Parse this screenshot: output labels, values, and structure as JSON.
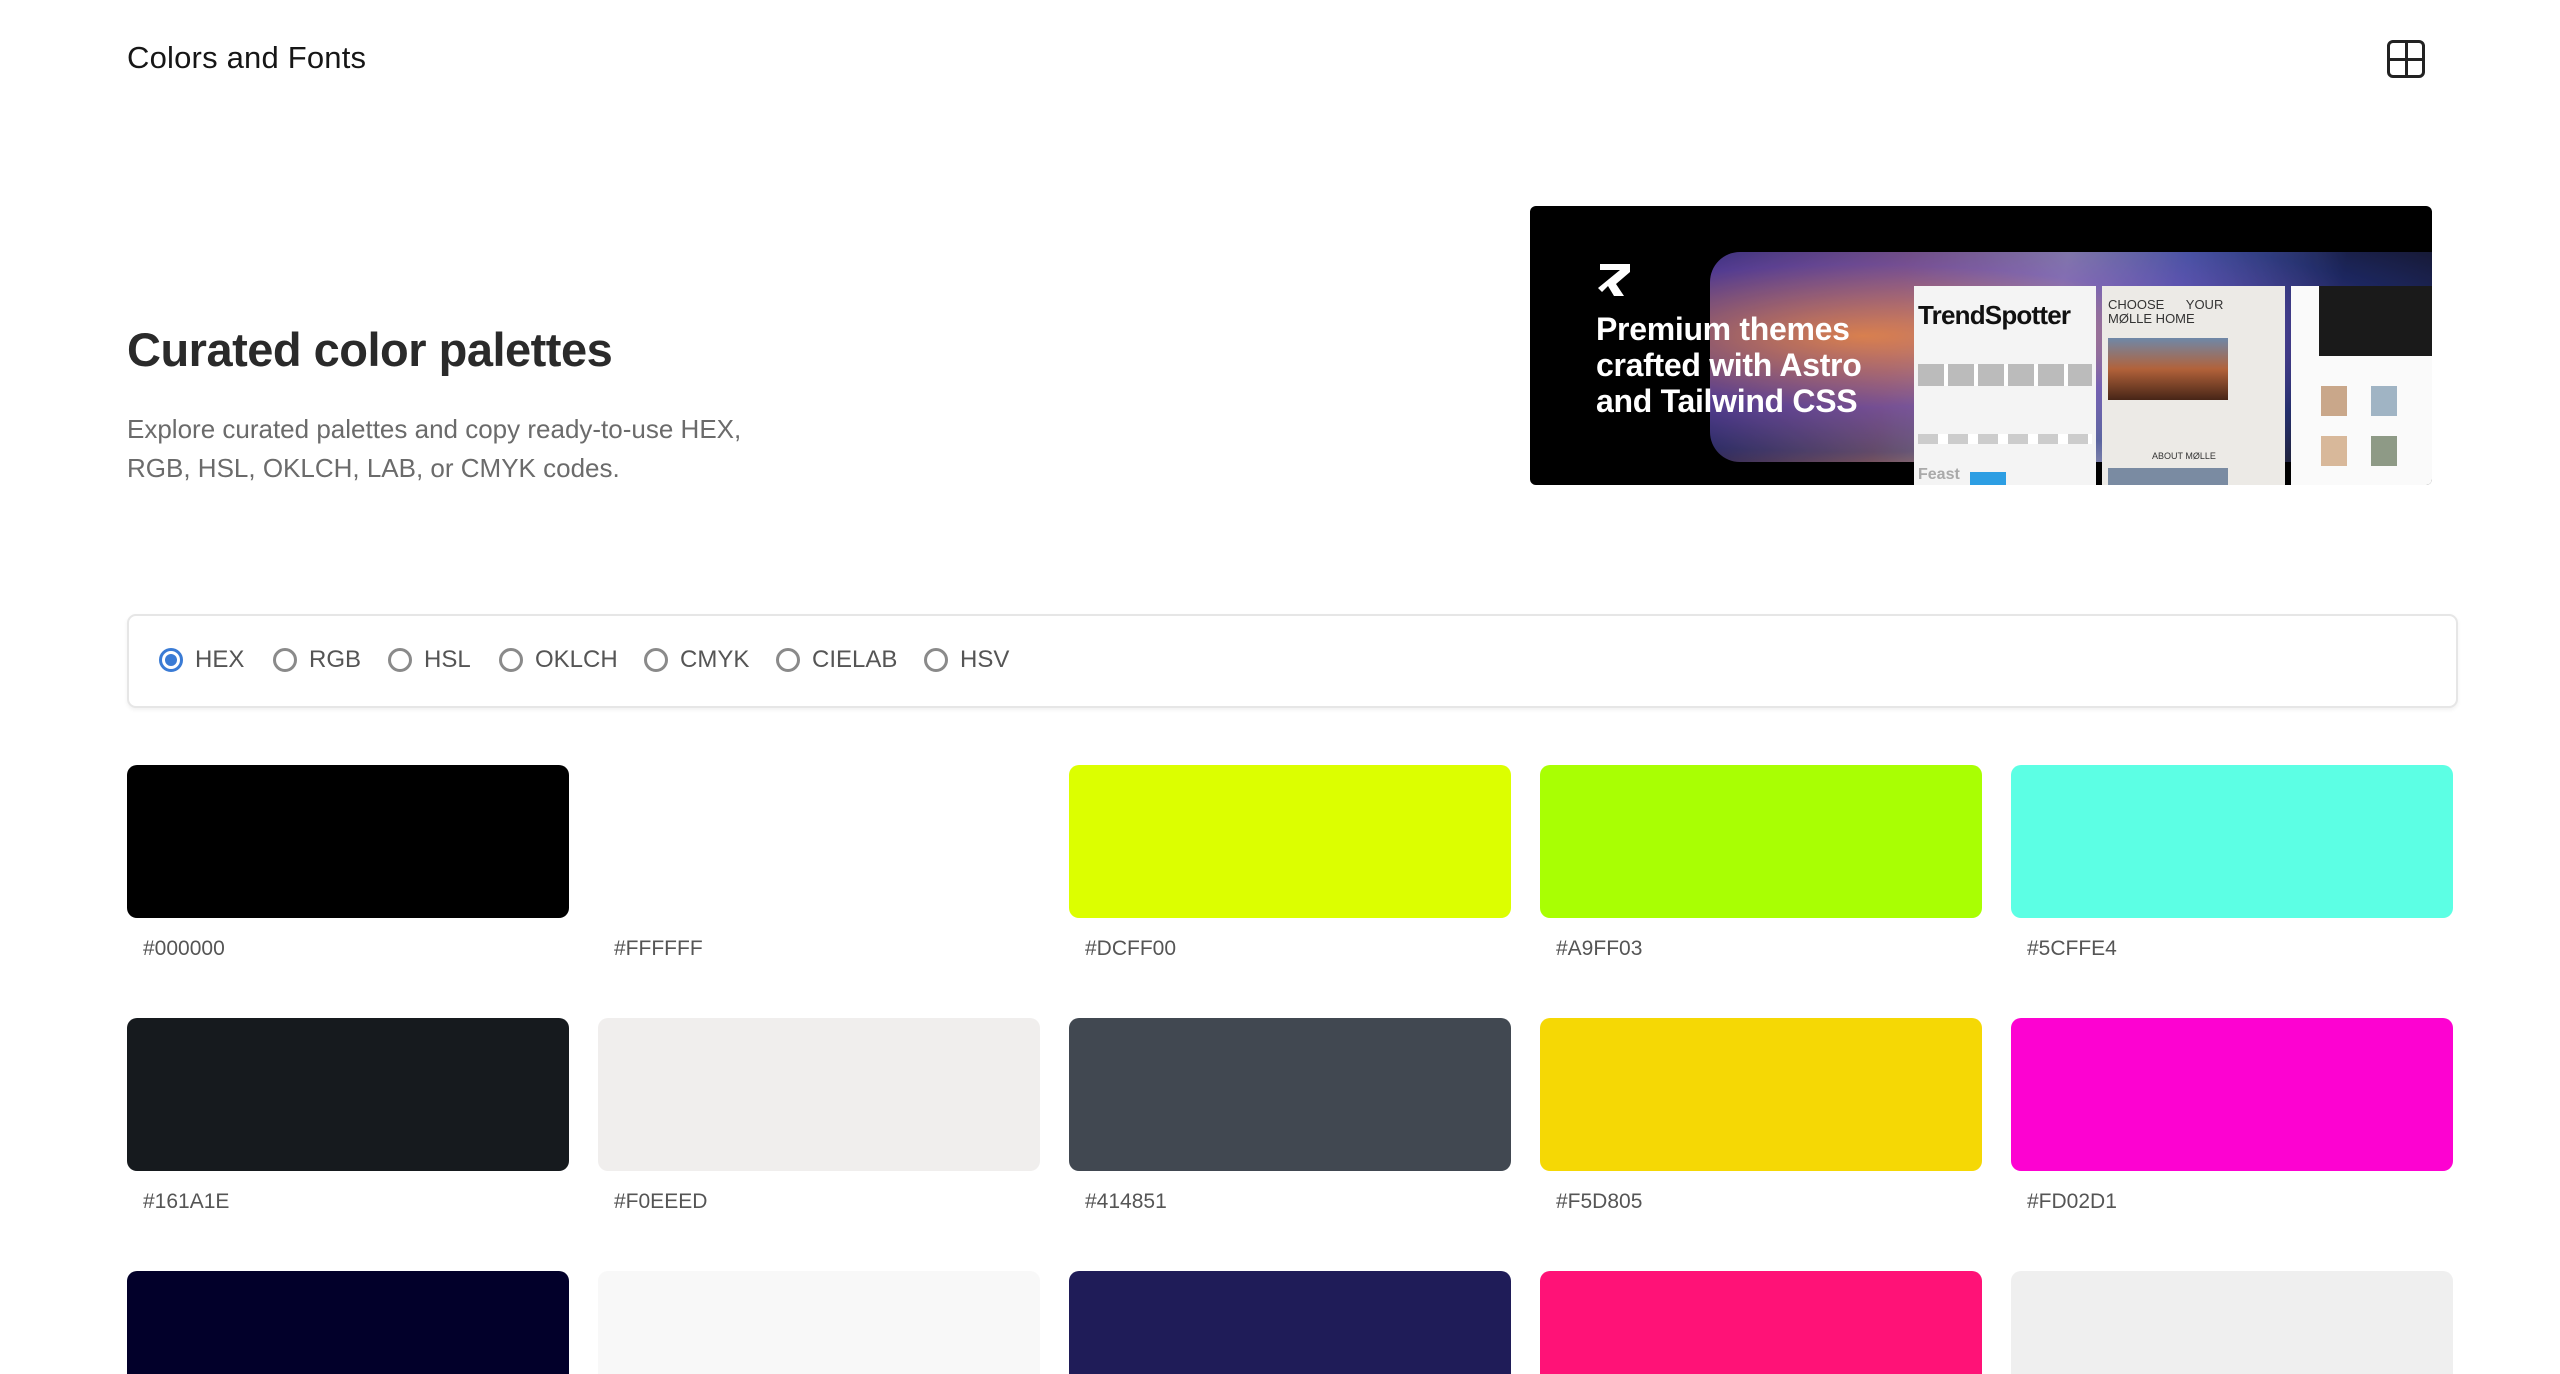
{
  "header": {
    "title": "Colors and Fonts",
    "menu_icon": "grid-layout-icon"
  },
  "hero": {
    "title": "Curated color palettes",
    "description": "Explore curated palettes and copy ready-to-use HEX, RGB, HSL, OKLCH, LAB, or CMYK codes."
  },
  "ad": {
    "logo_icon": "arrow-up-right-logo-icon",
    "headline": "Premium themes crafted with Astro and Tailwind CSS",
    "shot1_title": "TrendSpotter",
    "shot1_footer": "Feast",
    "shot2_header": "CHOOSE      YOUR\nMØLLE HOME",
    "shot2_caption": "ABOUT MØLLE"
  },
  "formats": {
    "selected": "HEX",
    "options": [
      "HEX",
      "RGB",
      "HSL",
      "OKLCH",
      "CMYK",
      "CIELAB",
      "HSV"
    ]
  },
  "swatches": [
    {
      "hex": "#000000",
      "color": "#000000"
    },
    {
      "hex": "#FFFFFF",
      "color": "#FFFFFF"
    },
    {
      "hex": "#DCFF00",
      "color": "#DCFF00"
    },
    {
      "hex": "#A9FF03",
      "color": "#A9FF03"
    },
    {
      "hex": "#5CFFE4",
      "color": "#5CFFE4"
    },
    {
      "hex": "#161A1E",
      "color": "#161A1E"
    },
    {
      "hex": "#F0EEED",
      "color": "#F0EEED"
    },
    {
      "hex": "#414851",
      "color": "#414851"
    },
    {
      "hex": "#F5D805",
      "color": "#F5D805"
    },
    {
      "hex": "#FD02D1",
      "color": "#FD02D1"
    },
    {
      "hex": "",
      "color": "#02002A"
    },
    {
      "hex": "",
      "color": "#F8F8F8"
    },
    {
      "hex": "",
      "color": "#1F1C58"
    },
    {
      "hex": "",
      "color": "#FF1277"
    },
    {
      "hex": "",
      "color": "#EFEFEF"
    }
  ]
}
